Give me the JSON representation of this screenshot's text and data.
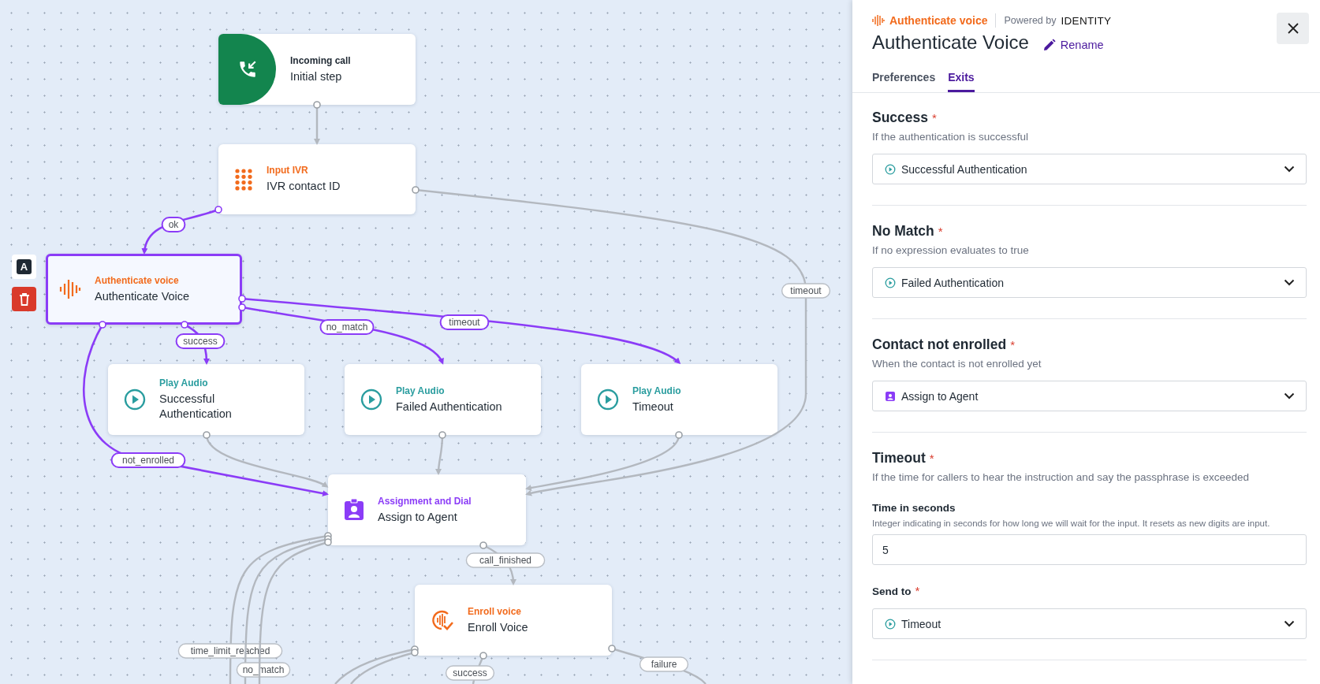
{
  "canvas": {
    "toolbar": [
      {
        "kind": "glyph",
        "glyph": "A"
      },
      {
        "kind": "delete"
      }
    ],
    "nodes": [
      {
        "kind": "incoming",
        "type_label": "Incoming call",
        "title": "Initial step",
        "selected": false
      },
      {
        "kind": "ivr",
        "type_label": "Input IVR",
        "title": "IVR contact ID",
        "selected": false
      },
      {
        "kind": "voice",
        "type_label": "Authenticate voice",
        "title": "Authenticate Voice",
        "selected": true
      },
      {
        "kind": "audio",
        "type_label": "Play Audio",
        "title": "Successful Authentication",
        "selected": false
      },
      {
        "kind": "audio",
        "type_label": "Play Audio",
        "title": "Failed Authentication",
        "selected": false
      },
      {
        "kind": "audio",
        "type_label": "Play Audio",
        "title": "Timeout",
        "selected": false
      },
      {
        "kind": "assign",
        "type_label": "Assignment and Dial",
        "title": "Assign to Agent",
        "selected": false
      },
      {
        "kind": "enroll",
        "type_label": "Enroll voice",
        "title": "Enroll Voice",
        "selected": false
      }
    ],
    "edges": [
      {
        "highlighted": false
      },
      {
        "label": "ok",
        "highlighted": true
      },
      {
        "label": "timeout",
        "highlighted": false
      },
      {
        "label": "success",
        "highlighted": true
      },
      {
        "label": "no_match",
        "highlighted": true
      },
      {
        "label": "timeout",
        "highlighted": true
      },
      {
        "label": "not_enrolled",
        "highlighted": true
      },
      {
        "highlighted": false
      },
      {
        "highlighted": false
      },
      {
        "highlighted": false
      },
      {
        "label": "call_finished",
        "highlighted": false
      },
      {
        "label": "success",
        "highlighted": false
      },
      {
        "label": "failure",
        "highlighted": false
      },
      {
        "label": "time_limit_reached",
        "highlighted": false
      },
      {
        "label": "no_match",
        "highlighted": false
      },
      {
        "highlighted": false
      },
      {
        "highlighted": false
      },
      {
        "highlighted": false
      }
    ]
  },
  "panel": {
    "type_label": "Authenticate voice",
    "powered_by": "Powered by",
    "brand": "IDENTITY",
    "title": "Authenticate Voice",
    "rename": "Rename",
    "tabs": [
      {
        "label": "Preferences",
        "selected": false
      },
      {
        "label": "Exits",
        "selected": true
      }
    ],
    "sections": [
      {
        "title": "Success",
        "mark": "*",
        "description": "If the authentication is successful",
        "fields": [
          {
            "kind": "select",
            "value": "Successful Authentication"
          }
        ]
      },
      {
        "title": "No Match",
        "mark": "*",
        "description": "If no expression evaluates to true",
        "fields": [
          {
            "kind": "select",
            "value": "Failed Authentication"
          }
        ]
      },
      {
        "title": "Contact not enrolled",
        "mark": "*",
        "description": "When the contact is not enrolled yet",
        "fields": [
          {
            "kind": "select",
            "value": "Assign to Agent"
          }
        ]
      },
      {
        "title": "Timeout",
        "mark": "*",
        "description": "If the time for callers to hear the instruction and say the passphrase is exceeded",
        "fields": [
          {
            "kind": "number",
            "label": "Time in seconds",
            "help": "Integer indicating in seconds for how long we will wait for the input. It resets as new digits are input.",
            "value": "5"
          },
          {
            "kind": "select",
            "label": "Send to",
            "mark": "*",
            "value": "Timeout"
          }
        ]
      }
    ]
  }
}
